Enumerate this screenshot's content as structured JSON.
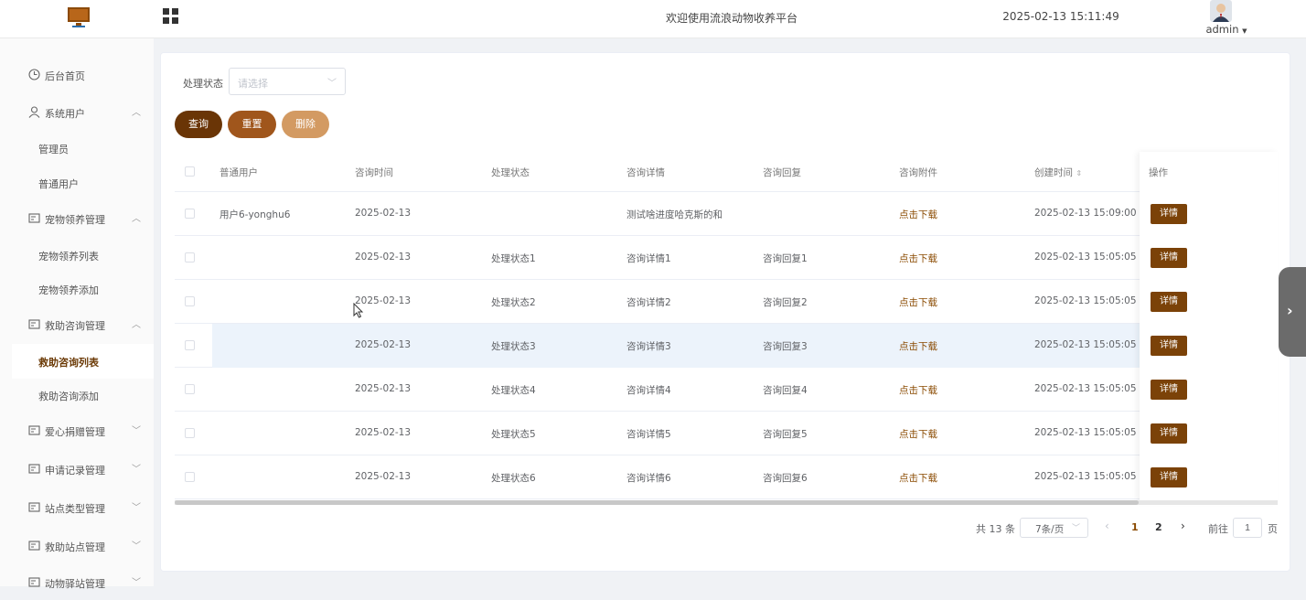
{
  "header": {
    "title": "欢迎使用流浪动物收养平台",
    "datetime": "2025-02-13 15:11:49",
    "user": "admin"
  },
  "sidebar": {
    "items": [
      {
        "label": "后台首页",
        "icon": "clock-icon"
      },
      {
        "label": "系统用户",
        "icon": "user-icon",
        "expanded": true
      },
      {
        "label": "管理员"
      },
      {
        "label": "普通用户"
      },
      {
        "label": "宠物领养管理",
        "icon": "list-icon",
        "expanded": true
      },
      {
        "label": "宠物领养列表"
      },
      {
        "label": "宠物领养添加"
      },
      {
        "label": "救助咨询管理",
        "icon": "list-icon",
        "expanded": true
      },
      {
        "label": "救助咨询列表",
        "active": true
      },
      {
        "label": "救助咨询添加"
      },
      {
        "label": "爱心捐赠管理",
        "icon": "list-icon"
      },
      {
        "label": "申请记录管理",
        "icon": "list-icon"
      },
      {
        "label": "站点类型管理",
        "icon": "list-icon"
      },
      {
        "label": "救助站点管理",
        "icon": "list-icon"
      },
      {
        "label": "动物驿站管理",
        "icon": "list-icon"
      }
    ]
  },
  "filter": {
    "label": "处理状态",
    "placeholder": "请选择"
  },
  "buttons": {
    "query": "查询",
    "reset": "重置",
    "delete": "删除"
  },
  "table": {
    "columns": [
      "普通用户",
      "咨询时间",
      "处理状态",
      "咨询详情",
      "咨询回复",
      "咨询附件",
      "创建时间",
      "操作"
    ],
    "rows": [
      {
        "user": "用户6-yonghu6",
        "time": "2025-02-13",
        "status": "",
        "detail": "测试啥进度哈克斯的和",
        "reply": "",
        "attach": "点击下载",
        "created": "2025-02-13 15:09:00",
        "op": "详情"
      },
      {
        "user": "",
        "time": "2025-02-13",
        "status": "处理状态1",
        "detail": "咨询详情1",
        "reply": "咨询回复1",
        "attach": "点击下载",
        "created": "2025-02-13 15:05:05",
        "op": "详情"
      },
      {
        "user": "",
        "time": "2025-02-13",
        "status": "处理状态2",
        "detail": "咨询详情2",
        "reply": "咨询回复2",
        "attach": "点击下载",
        "created": "2025-02-13 15:05:05",
        "op": "详情"
      },
      {
        "user": "",
        "time": "2025-02-13",
        "status": "处理状态3",
        "detail": "咨询详情3",
        "reply": "咨询回复3",
        "attach": "点击下载",
        "created": "2025-02-13 15:05:05",
        "op": "详情"
      },
      {
        "user": "",
        "time": "2025-02-13",
        "status": "处理状态4",
        "detail": "咨询详情4",
        "reply": "咨询回复4",
        "attach": "点击下载",
        "created": "2025-02-13 15:05:05",
        "op": "详情"
      },
      {
        "user": "",
        "time": "2025-02-13",
        "status": "处理状态5",
        "detail": "咨询详情5",
        "reply": "咨询回复5",
        "attach": "点击下载",
        "created": "2025-02-13 15:05:05",
        "op": "详情"
      },
      {
        "user": "",
        "time": "2025-02-13",
        "status": "处理状态6",
        "detail": "咨询详情6",
        "reply": "咨询回复6",
        "attach": "点击下载",
        "created": "2025-02-13 15:05:05",
        "op": "详情"
      }
    ]
  },
  "pagination": {
    "total": "共 13 条",
    "page_size": "7条/页",
    "pages": [
      "1",
      "2"
    ],
    "current": "1",
    "goto_label": "前往",
    "goto_value": "1",
    "page_unit": "页"
  },
  "colors": {
    "primary": "#6a3506",
    "reset": "#a0561c",
    "delete": "#d39a62",
    "link": "#8a4a00"
  }
}
